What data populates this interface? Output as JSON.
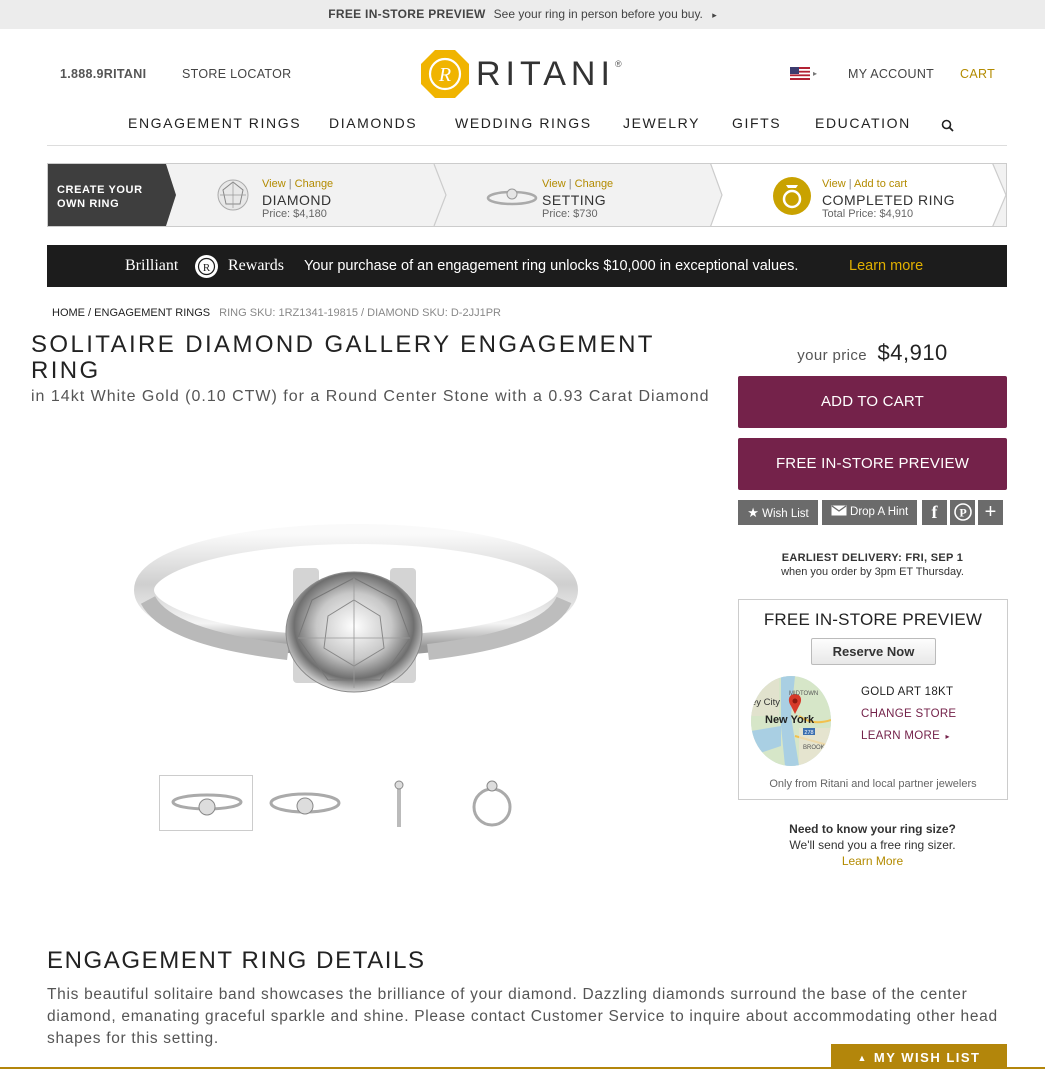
{
  "promo": {
    "title": "FREE IN-STORE PREVIEW",
    "text": "See your ring in person before you buy.",
    "arrow": "▸"
  },
  "header": {
    "phone": "1.888.9RITANI",
    "store_locator": "STORE LOCATOR",
    "brand": "RITANI",
    "registered": "®",
    "my_account": "MY ACCOUNT",
    "cart": "CART",
    "flag_arrow": "▸"
  },
  "nav": {
    "items": [
      "ENGAGEMENT RINGS",
      "DIAMONDS",
      "WEDDING RINGS",
      "JEWELRY",
      "GIFTS",
      "EDUCATION"
    ]
  },
  "builder": {
    "create": [
      "CREATE YOUR",
      "OWN RING"
    ],
    "steps": [
      {
        "view": "View",
        "sep": " | ",
        "action": "Change",
        "title": "DIAMOND",
        "price": "Price: $4,180"
      },
      {
        "view": "View",
        "sep": " | ",
        "action": "Change",
        "title": "SETTING",
        "price": "Price: $730"
      },
      {
        "view": "View",
        "sep": " | ",
        "action": "Add to cart",
        "title": "COMPLETED RING",
        "price": "Total Price: $4,910"
      }
    ]
  },
  "rewards": {
    "brand_left": "Brilliant",
    "brand_right": "Rewards",
    "text": "Your purchase of an engagement ring unlocks $10,000 in exceptional values.",
    "link": "Learn more"
  },
  "breadcrumb": {
    "home": "HOME",
    "sep": " / ",
    "category": "ENGAGEMENT RINGS",
    "sku": "RING SKU: 1RZ1341-19815 / DIAMOND SKU: D-2JJ1PR"
  },
  "product": {
    "title": "SOLITAIRE DIAMOND GALLERY ENGAGEMENT RING",
    "subtitle": "in 14kt White Gold (0.10 CTW) for a Round Center Stone with a 0.93 Carat Diamond",
    "price_label": "your price",
    "price": "$4,910"
  },
  "actions": {
    "add_to_cart": "ADD TO CART",
    "preview": "FREE IN-STORE PREVIEW",
    "wish_list": "Wish List",
    "drop_hint": "Drop A Hint"
  },
  "delivery": {
    "title": "EARLIEST DELIVERY: FRI, SEP 1",
    "note": "when you order by 3pm ET Thursday."
  },
  "store_preview": {
    "title": "FREE IN-STORE PREVIEW",
    "reserve": "Reserve Now",
    "store_name": "GOLD ART 18KT",
    "change": "CHANGE STORE",
    "learn": "LEARN MORE",
    "learn_arrow": "▸",
    "map_labels": {
      "city": "New York",
      "jersey": "ey City",
      "midtown": "MIDTOWN",
      "brooklyn": "BROOKL",
      "route": "278"
    },
    "footer": "Only from Ritani and local partner jewelers"
  },
  "ring_size": {
    "title": "Need to know your ring size?",
    "text": "We'll send you a free ring sizer.",
    "link": "Learn More"
  },
  "details": {
    "heading": "ENGAGEMENT RING DETAILS",
    "body": "This beautiful solitaire band showcases the brilliance of your diamond. Dazzling diamonds surround the base of the center diamond, emanating graceful sparkle and shine. Please contact Customer Service to inquire about accommodating other head shapes for this setting."
  },
  "wish_tab": {
    "arrow": "▲",
    "label": "MY WISH LIST"
  },
  "colors": {
    "brand_gold": "#f0b400",
    "accent_gold": "#b38b00",
    "button_plum": "#74224a",
    "dark_bar": "#1c1c1c"
  },
  "icons": [
    "flag-icon",
    "search-icon",
    "star-icon",
    "envelope-icon",
    "facebook-icon",
    "pinterest-icon",
    "plus-icon",
    "map-pin-icon",
    "ring-icon",
    "diamond-icon"
  ]
}
